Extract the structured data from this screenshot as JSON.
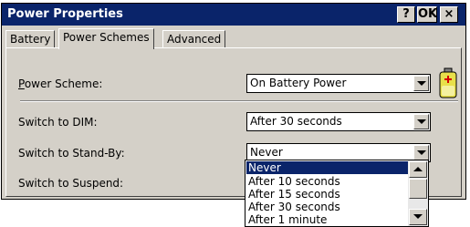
{
  "window": {
    "title": "Power Properties",
    "help_label": "?",
    "ok_label": "OK",
    "close_label": "×"
  },
  "tabs": [
    {
      "label": "Battery",
      "selected": false
    },
    {
      "label": "Power Schemes",
      "selected": true
    },
    {
      "label": "Advanced",
      "selected": false
    }
  ],
  "form": {
    "power_scheme": {
      "label_first": "P",
      "label_rest": "ower Scheme:",
      "value": "On Battery Power"
    },
    "dim": {
      "label": "Switch to DIM:",
      "value": "After 30 seconds"
    },
    "standby": {
      "label": "Switch to Stand-By:",
      "value": "Never"
    },
    "suspend": {
      "label": "Switch to Suspend:"
    }
  },
  "dropdown": {
    "options": [
      "Never",
      "After 10 seconds",
      "After 15 seconds",
      "After 30 seconds",
      "After 1 minute"
    ],
    "selected_index": 0
  },
  "icons": {
    "battery": "battery-icon",
    "arrow": "chevron-down-icon"
  },
  "colors": {
    "titlebar": "#0a246a",
    "face": "#d4d0c8",
    "battery_body": "#e8e04a",
    "battery_plus": "#d40000"
  }
}
